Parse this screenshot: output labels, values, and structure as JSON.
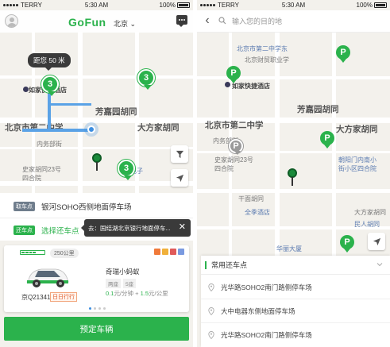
{
  "status": {
    "carrier": "TERRY",
    "time": "5:30 AM",
    "battery": "100%"
  },
  "left": {
    "logo": "GoFun",
    "city": "北京",
    "distance_bubble": "距您 50 米",
    "clusters": [
      "3",
      "3",
      "3"
    ],
    "map_labels": {
      "alley": "芳嘉园胡同",
      "middle_school": "北京市第二中学",
      "fangjia_alley": "大方家胡同",
      "neiwu": "内务部街",
      "shijia": "史家胡同23号\n四合院",
      "hotel": "如家快捷酒店",
      "zhongguo": "中国电子",
      "east_school": "北京市第二中学东",
      "school_small": "北京市第二中学"
    },
    "pickup_tag": "取车点",
    "pickup_text": "银河SOHO西侧地面停车场",
    "return_tag": "还车点",
    "return_text": "选择还车点",
    "tooltip_text": "去：国结湖北京银行地面停车...",
    "tooltip_close": "✕",
    "car": {
      "battery_level": 0.6,
      "range": "250公里",
      "name": "奇瑞小蚂蚁",
      "spec1": "两座",
      "spec2": "5座",
      "plate": "京Q21341",
      "daily_badge": "日日行行",
      "price_a": "0.1",
      "price_a_unit": "元/分钟",
      "price_plus": "+",
      "price_b": "1.5",
      "price_b_unit": "元/公里"
    },
    "book_button": "预定车辆"
  },
  "right": {
    "search_placeholder": "输入您的目的地",
    "map_labels": {
      "north": "北京市第二中学东",
      "fincollege": "北京财贸职业学",
      "hotel": "如家快捷酒店",
      "alley": "芳嘉园胡同",
      "middle_school": "北京市第二中学",
      "fangjia": "大方家胡同",
      "shijia": "史家胡同23号\n四合院",
      "neiwu": "内务部街",
      "ganmian": "干面胡同",
      "chaoyang": "朝阳门内南小\n街小区四合院",
      "quanji": "全季酒店",
      "huamao": "华丽大厦",
      "lushan": "民人胡同",
      "huayuan": "华丽厦",
      "daifang": "大方家胡同"
    },
    "common_title": "常用还车点",
    "common_items": [
      "光华路SOHO2南门路侧停车场",
      "大中电器东侧地面停车场",
      "光华路SOHO2南门路侧停车场"
    ]
  },
  "colors": {
    "brand_green": "#2bb24c",
    "route_blue": "#5aa2e6",
    "tooltip_dark": "#3a3a3a"
  }
}
